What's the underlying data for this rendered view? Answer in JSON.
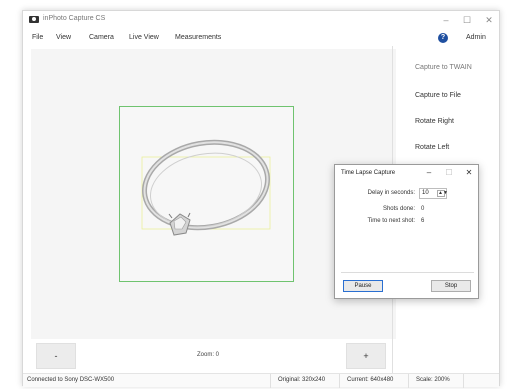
{
  "window": {
    "title": "inPhoto Capture CS",
    "minimize": "–",
    "maximize": "☐",
    "close": "✕"
  },
  "menu": {
    "items": [
      "File",
      "View",
      "Camera",
      "Live View",
      "Measurements"
    ],
    "help_icon": "?",
    "admin": "Admin"
  },
  "side_panel": {
    "buttons": [
      "Capture to TWAIN",
      "Capture to File",
      "Rotate Right",
      "Rotate Left"
    ]
  },
  "bottom": {
    "minus_label": "-",
    "zoom_label": "Zoom: 0",
    "plus_label": "+"
  },
  "status": {
    "connection": "Connected to Sony DSC-WX500",
    "original": "Original: 320x240",
    "current": "Current: 640x480",
    "scale": "Scale: 200%"
  },
  "dialog": {
    "title": "Time Lapse Capture",
    "minimize": "–",
    "maximize": "☐",
    "close": "✕",
    "delay_label": "Delay in seconds:",
    "delay_value": "10",
    "spinner": "▲▼",
    "shots_label": "Shots done:",
    "shots_value": "0",
    "next_label": "Time to next shot:",
    "next_value": "6",
    "pause_label": "Pause",
    "stop_label": "Stop"
  },
  "colors": {
    "frame": "#6fc36f",
    "help_icon": "#1f4fa0",
    "focus": "#2a6fd1"
  },
  "icons": {
    "app": "camera-icon",
    "help": "help-icon"
  }
}
